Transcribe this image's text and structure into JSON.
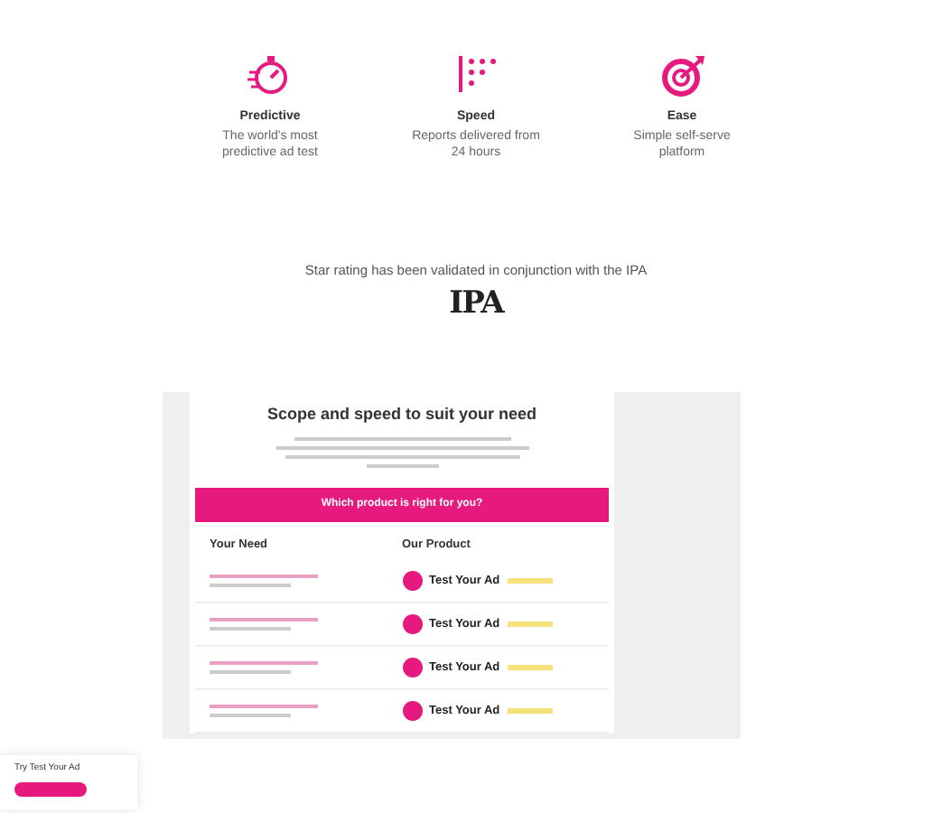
{
  "features": [
    {
      "kind": "stopwatch",
      "title": "Predictive",
      "text": "The world's most predictive ad test"
    },
    {
      "kind": "dots",
      "title": "Speed",
      "text": "Reports delivered from 24 hours"
    },
    {
      "kind": "target",
      "title": "Ease",
      "text": "Simple self-serve platform"
    }
  ],
  "validation": {
    "text": "Star rating has been validated in conjunction with the IPA",
    "logo": "IPA"
  },
  "products": {
    "title": "Scope and speed to suit your need",
    "banner": "Which product is right for you?",
    "columns": [
      "Your Need",
      "Our Product"
    ],
    "rows": [
      {
        "product": "Test Your Ad"
      },
      {
        "product": "Test Your Ad"
      },
      {
        "product": "Test Your Ad"
      },
      {
        "product": "Test Your Ad"
      }
    ]
  },
  "promo": {
    "text": "Try Test Your Ad"
  }
}
